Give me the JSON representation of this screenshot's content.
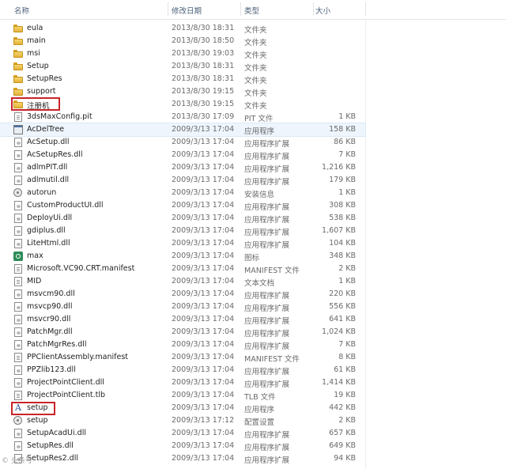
{
  "columns": {
    "name": "名称",
    "date": "修改日期",
    "type": "类型",
    "size": "大小"
  },
  "files": [
    {
      "name": "eula",
      "date": "2013/8/30 18:31",
      "type": "文件夹",
      "size": "",
      "icon": "folder-icon"
    },
    {
      "name": "main",
      "date": "2013/8/30 18:50",
      "type": "文件夹",
      "size": "",
      "icon": "folder-icon"
    },
    {
      "name": "msi",
      "date": "2013/8/30 19:03",
      "type": "文件夹",
      "size": "",
      "icon": "folder-icon"
    },
    {
      "name": "Setup",
      "date": "2013/8/30 18:31",
      "type": "文件夹",
      "size": "",
      "icon": "folder-icon"
    },
    {
      "name": "SetupRes",
      "date": "2013/8/30 18:31",
      "type": "文件夹",
      "size": "",
      "icon": "folder-icon"
    },
    {
      "name": "support",
      "date": "2013/8/30 19:15",
      "type": "文件夹",
      "size": "",
      "icon": "folder-icon"
    },
    {
      "name": "注册机",
      "date": "2013/8/30 19:15",
      "type": "文件夹",
      "size": "",
      "icon": "folder-icon"
    },
    {
      "name": "3dsMaxConfig.pit",
      "date": "2013/8/30 17:09",
      "type": "PIT 文件",
      "size": "1 KB",
      "icon": "document-icon"
    },
    {
      "name": "AcDelTree",
      "date": "2009/3/13 17:04",
      "type": "应用程序",
      "size": "158 KB",
      "icon": "application-icon"
    },
    {
      "name": "AcSetup.dll",
      "date": "2009/3/13 17:04",
      "type": "应用程序扩展",
      "size": "86 KB",
      "icon": "dll-icon"
    },
    {
      "name": "AcSetupRes.dll",
      "date": "2009/3/13 17:04",
      "type": "应用程序扩展",
      "size": "7 KB",
      "icon": "dll-icon"
    },
    {
      "name": "adlmPIT.dll",
      "date": "2009/3/13 17:04",
      "type": "应用程序扩展",
      "size": "1,216 KB",
      "icon": "dll-icon"
    },
    {
      "name": "adlmutil.dll",
      "date": "2009/3/13 17:04",
      "type": "应用程序扩展",
      "size": "179 KB",
      "icon": "dll-icon"
    },
    {
      "name": "autorun",
      "date": "2009/3/13 17:04",
      "type": "安装信息",
      "size": "1 KB",
      "icon": "gear-icon"
    },
    {
      "name": "CustomProductUI.dll",
      "date": "2009/3/13 17:04",
      "type": "应用程序扩展",
      "size": "308 KB",
      "icon": "dll-icon"
    },
    {
      "name": "DeployUi.dll",
      "date": "2009/3/13 17:04",
      "type": "应用程序扩展",
      "size": "538 KB",
      "icon": "dll-icon"
    },
    {
      "name": "gdiplus.dll",
      "date": "2009/3/13 17:04",
      "type": "应用程序扩展",
      "size": "1,607 KB",
      "icon": "dll-icon"
    },
    {
      "name": "LiteHtml.dll",
      "date": "2009/3/13 17:04",
      "type": "应用程序扩展",
      "size": "104 KB",
      "icon": "dll-icon"
    },
    {
      "name": "max",
      "date": "2009/3/13 17:04",
      "type": "图标",
      "size": "348 KB",
      "icon": "max-icon"
    },
    {
      "name": "Microsoft.VC90.CRT.manifest",
      "date": "2009/3/13 17:04",
      "type": "MANIFEST 文件",
      "size": "2 KB",
      "icon": "document-icon"
    },
    {
      "name": "MID",
      "date": "2009/3/13 17:04",
      "type": "文本文档",
      "size": "1 KB",
      "icon": "document-icon"
    },
    {
      "name": "msvcm90.dll",
      "date": "2009/3/13 17:04",
      "type": "应用程序扩展",
      "size": "220 KB",
      "icon": "dll-icon"
    },
    {
      "name": "msvcp90.dll",
      "date": "2009/3/13 17:04",
      "type": "应用程序扩展",
      "size": "556 KB",
      "icon": "dll-icon"
    },
    {
      "name": "msvcr90.dll",
      "date": "2009/3/13 17:04",
      "type": "应用程序扩展",
      "size": "641 KB",
      "icon": "dll-icon"
    },
    {
      "name": "PatchMgr.dll",
      "date": "2009/3/13 17:04",
      "type": "应用程序扩展",
      "size": "1,024 KB",
      "icon": "dll-icon"
    },
    {
      "name": "PatchMgrRes.dll",
      "date": "2009/3/13 17:04",
      "type": "应用程序扩展",
      "size": "7 KB",
      "icon": "dll-icon"
    },
    {
      "name": "PPClientAssembly.manifest",
      "date": "2009/3/13 17:04",
      "type": "MANIFEST 文件",
      "size": "8 KB",
      "icon": "document-icon"
    },
    {
      "name": "PPZlib123.dll",
      "date": "2009/3/13 17:04",
      "type": "应用程序扩展",
      "size": "61 KB",
      "icon": "dll-icon"
    },
    {
      "name": "ProjectPointClient.dll",
      "date": "2009/3/13 17:04",
      "type": "应用程序扩展",
      "size": "1,414 KB",
      "icon": "dll-icon"
    },
    {
      "name": "ProjectPointClient.tlb",
      "date": "2009/3/13 17:04",
      "type": "TLB 文件",
      "size": "19 KB",
      "icon": "document-icon"
    },
    {
      "name": "setup",
      "date": "2009/3/13 17:04",
      "type": "应用程序",
      "size": "442 KB",
      "icon": "setup-app-icon"
    },
    {
      "name": "setup",
      "date": "2009/3/13 17:12",
      "type": "配置设置",
      "size": "2 KB",
      "icon": "gear-icon"
    },
    {
      "name": "SetupAcadUi.dll",
      "date": "2009/3/13 17:04",
      "type": "应用程序扩展",
      "size": "657 KB",
      "icon": "dll-icon"
    },
    {
      "name": "SetupRes.dll",
      "date": "2009/3/13 17:04",
      "type": "应用程序扩展",
      "size": "649 KB",
      "icon": "dll-icon"
    },
    {
      "name": "SetupRes2.dll",
      "date": "2009/3/13 17:04",
      "type": "应用程序扩展",
      "size": "94 KB",
      "icon": "dll-icon"
    }
  ],
  "selected_row": "AcDelTree",
  "highlighted_rows": [
    "注册机",
    "setup"
  ],
  "watermark": "© 头条号",
  "colors": {
    "highlight": "#c8242a",
    "folder": "#e3b23a",
    "header_text": "#4c607a",
    "selection": "#eef5fd"
  }
}
